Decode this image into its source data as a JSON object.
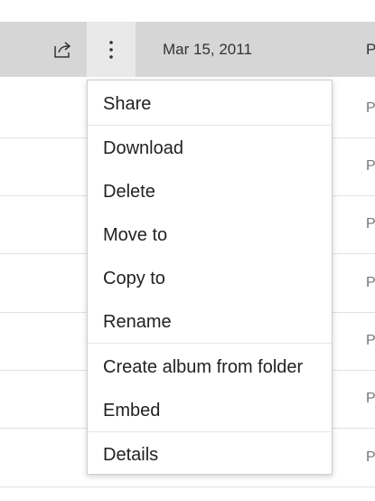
{
  "header": {
    "share_icon": "share-icon",
    "more_icon": "more-vertical-icon",
    "date": "Mar 15, 2011",
    "truncated_column": "P"
  },
  "rows": [
    {
      "truncated": "P"
    },
    {
      "truncated": "P"
    },
    {
      "truncated": "P"
    },
    {
      "truncated": "P"
    },
    {
      "truncated": "P"
    },
    {
      "truncated": "P"
    },
    {
      "truncated": "P"
    }
  ],
  "context_menu": {
    "items": [
      {
        "label": "Share"
      },
      {
        "label": "Download"
      },
      {
        "label": "Delete"
      },
      {
        "label": "Move to"
      },
      {
        "label": "Copy to"
      },
      {
        "label": "Rename"
      },
      {
        "label": "Create album from folder"
      },
      {
        "label": "Embed"
      },
      {
        "label": "Details"
      }
    ]
  },
  "colors": {
    "header_bg": "#d6d6d6",
    "active_button_bg": "#e9e9e9",
    "text": "#222222",
    "divider": "#e1e1e1"
  }
}
